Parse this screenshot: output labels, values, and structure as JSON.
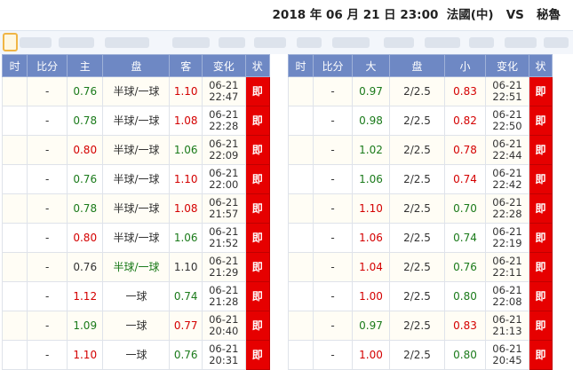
{
  "header": {
    "date": "2018 年 06 月 21 日 23:00",
    "home": "法國(中)",
    "vs": "VS",
    "away": "秘魯"
  },
  "handicap_table": {
    "headers": [
      "时",
      "比分",
      "主",
      "盘",
      "客",
      "变化",
      "状"
    ],
    "rows": [
      {
        "score": "-",
        "home": "0.76",
        "home_color": "green",
        "line": "半球/一球",
        "line_color": "black",
        "away": "1.10",
        "away_color": "red",
        "date": "06-21",
        "time": "22:47",
        "status": "即"
      },
      {
        "score": "-",
        "home": "0.78",
        "home_color": "green",
        "line": "半球/一球",
        "line_color": "black",
        "away": "1.08",
        "away_color": "red",
        "date": "06-21",
        "time": "22:28",
        "status": "即"
      },
      {
        "score": "-",
        "home": "0.80",
        "home_color": "red",
        "line": "半球/一球",
        "line_color": "black",
        "away": "1.06",
        "away_color": "green",
        "date": "06-21",
        "time": "22:09",
        "status": "即"
      },
      {
        "score": "-",
        "home": "0.76",
        "home_color": "green",
        "line": "半球/一球",
        "line_color": "black",
        "away": "1.10",
        "away_color": "red",
        "date": "06-21",
        "time": "22:00",
        "status": "即"
      },
      {
        "score": "-",
        "home": "0.78",
        "home_color": "green",
        "line": "半球/一球",
        "line_color": "black",
        "away": "1.08",
        "away_color": "red",
        "date": "06-21",
        "time": "21:57",
        "status": "即"
      },
      {
        "score": "-",
        "home": "0.80",
        "home_color": "red",
        "line": "半球/一球",
        "line_color": "black",
        "away": "1.06",
        "away_color": "green",
        "date": "06-21",
        "time": "21:52",
        "status": "即"
      },
      {
        "score": "-",
        "home": "0.76",
        "home_color": "black",
        "line": "半球/一球",
        "line_color": "green",
        "away": "1.10",
        "away_color": "black",
        "date": "06-21",
        "time": "21:29",
        "status": "即"
      },
      {
        "score": "-",
        "home": "1.12",
        "home_color": "red",
        "line": "一球",
        "line_color": "black",
        "away": "0.74",
        "away_color": "green",
        "date": "06-21",
        "time": "21:28",
        "status": "即"
      },
      {
        "score": "-",
        "home": "1.09",
        "home_color": "green",
        "line": "一球",
        "line_color": "black",
        "away": "0.77",
        "away_color": "red",
        "date": "06-21",
        "time": "20:40",
        "status": "即"
      },
      {
        "score": "-",
        "home": "1.10",
        "home_color": "red",
        "line": "一球",
        "line_color": "black",
        "away": "0.76",
        "away_color": "green",
        "date": "06-21",
        "time": "20:31",
        "status": "即"
      }
    ]
  },
  "total_table": {
    "headers": [
      "时",
      "比分",
      "大",
      "盘",
      "小",
      "变化",
      "状"
    ],
    "rows": [
      {
        "score": "-",
        "over": "0.97",
        "over_color": "green",
        "line": "2/2.5",
        "under": "0.83",
        "under_color": "red",
        "date": "06-21",
        "time": "22:51",
        "status": "即"
      },
      {
        "score": "-",
        "over": "0.98",
        "over_color": "green",
        "line": "2/2.5",
        "under": "0.82",
        "under_color": "red",
        "date": "06-21",
        "time": "22:50",
        "status": "即"
      },
      {
        "score": "-",
        "over": "1.02",
        "over_color": "green",
        "line": "2/2.5",
        "under": "0.78",
        "under_color": "red",
        "date": "06-21",
        "time": "22:44",
        "status": "即"
      },
      {
        "score": "-",
        "over": "1.06",
        "over_color": "green",
        "line": "2/2.5",
        "under": "0.74",
        "under_color": "red",
        "date": "06-21",
        "time": "22:42",
        "status": "即"
      },
      {
        "score": "-",
        "over": "1.10",
        "over_color": "red",
        "line": "2/2.5",
        "under": "0.70",
        "under_color": "green",
        "date": "06-21",
        "time": "22:28",
        "status": "即"
      },
      {
        "score": "-",
        "over": "1.06",
        "over_color": "red",
        "line": "2/2.5",
        "under": "0.74",
        "under_color": "green",
        "date": "06-21",
        "time": "22:19",
        "status": "即"
      },
      {
        "score": "-",
        "over": "1.04",
        "over_color": "red",
        "line": "2/2.5",
        "under": "0.76",
        "under_color": "green",
        "date": "06-21",
        "time": "22:11",
        "status": "即"
      },
      {
        "score": "-",
        "over": "1.00",
        "over_color": "red",
        "line": "2/2.5",
        "under": "0.80",
        "under_color": "green",
        "date": "06-21",
        "time": "22:08",
        "status": "即"
      },
      {
        "score": "-",
        "over": "0.97",
        "over_color": "green",
        "line": "2/2.5",
        "under": "0.83",
        "under_color": "red",
        "date": "06-21",
        "time": "21:13",
        "status": "即"
      },
      {
        "score": "-",
        "over": "1.00",
        "over_color": "red",
        "line": "2/2.5",
        "under": "0.80",
        "under_color": "green",
        "date": "06-21",
        "time": "20:45",
        "status": "即"
      }
    ]
  },
  "colors": {
    "header_bg": "#6e88c4",
    "status_bg": "#e60000",
    "green": "#1a7a1a",
    "red": "#d40000"
  }
}
